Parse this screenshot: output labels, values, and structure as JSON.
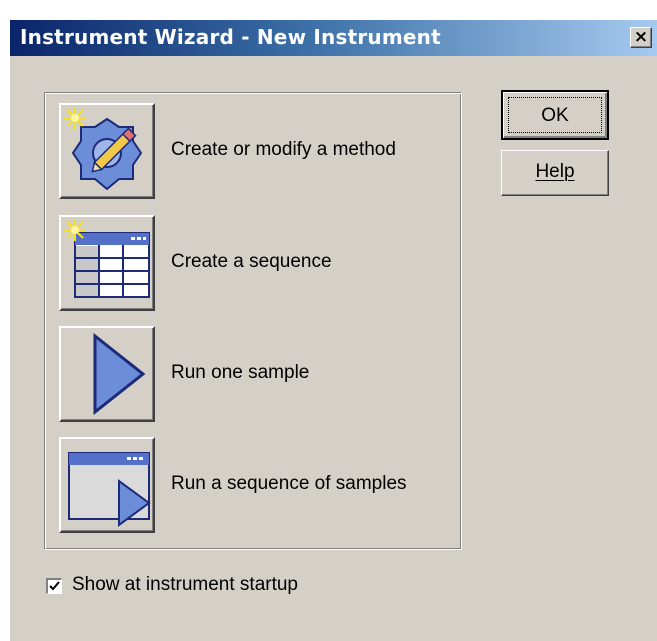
{
  "window": {
    "title": "Instrument Wizard - New Instrument",
    "close_label": "×"
  },
  "actions": [
    {
      "label": "Create or modify a method",
      "icon": "method-edit-icon"
    },
    {
      "label": "Create a sequence",
      "icon": "sequence-table-icon"
    },
    {
      "label": "Run one sample",
      "icon": "play-icon"
    },
    {
      "label": "Run a sequence of samples",
      "icon": "run-sequence-icon"
    }
  ],
  "buttons": {
    "ok_label": "OK",
    "help_label": "Help"
  },
  "startup_option": {
    "label": "Show at instrument startup",
    "checked": true
  },
  "colors": {
    "dialog_face": "#d4d0c8",
    "title_start": "#0a246a",
    "title_end": "#a6caf0",
    "icon_blue": "#6c8ed8",
    "icon_dark": "#1c2a78"
  }
}
